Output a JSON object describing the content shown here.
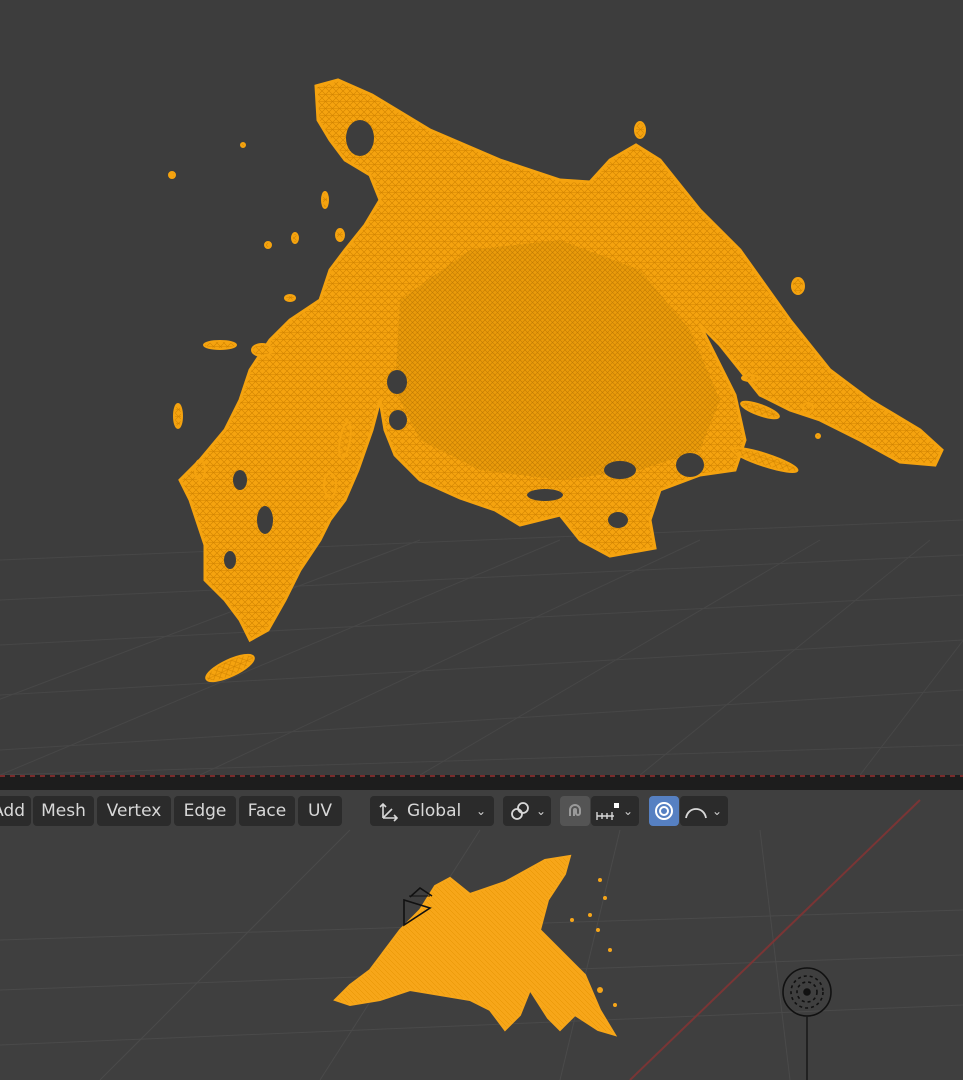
{
  "editor": {
    "mode": "Edit Mode",
    "colors": {
      "viewport_bg": "#3d3d3d",
      "grid": "#474747",
      "mesh": "#f5a30f",
      "mesh_wire": "#d88500",
      "x_axis": "#7a3535",
      "active_toggle": "#5680c2"
    }
  },
  "header_menu": {
    "add_label": "Add",
    "mesh_label": "Mesh",
    "vertex_label": "Vertex",
    "edge_label": "Edge",
    "face_label": "Face",
    "uv_label": "UV"
  },
  "transform": {
    "orientation_label": "Global",
    "orientation_icon": "transform-orientation-icon",
    "pivot_icon": "link-icon",
    "snap_icon": "magnet-icon",
    "snap_target_icon": "increment-icon",
    "proportional_icon": "proportional-edit-icon",
    "falloff_icon": "smooth-falloff-icon"
  },
  "overlays": {
    "light_icon": "light-object-icon",
    "camera_icon": "camera-object-icon"
  }
}
